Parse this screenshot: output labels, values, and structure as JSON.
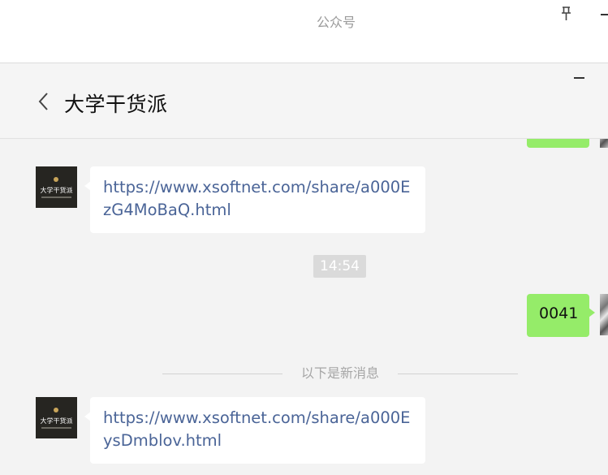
{
  "outer_window": {
    "title": "公众号"
  },
  "chat": {
    "title": "大学干货派"
  },
  "avatar": {
    "name": "大学干货派"
  },
  "messages": [
    {
      "type": "link",
      "sender": "other",
      "text": "https://www.xsoftnet.com/share/a000EzG4MoBaQ.html"
    },
    {
      "type": "time",
      "text": "14:54"
    },
    {
      "type": "text",
      "sender": "self",
      "text": "0041"
    },
    {
      "type": "divider",
      "text": "以下是新消息"
    },
    {
      "type": "link",
      "sender": "other",
      "text": "https://www.xsoftnet.com/share/a000EysDmblov.html"
    }
  ],
  "colors": {
    "self_bubble": "#95ec69",
    "link_text": "#4a6497",
    "background": "#f3f3f3"
  }
}
